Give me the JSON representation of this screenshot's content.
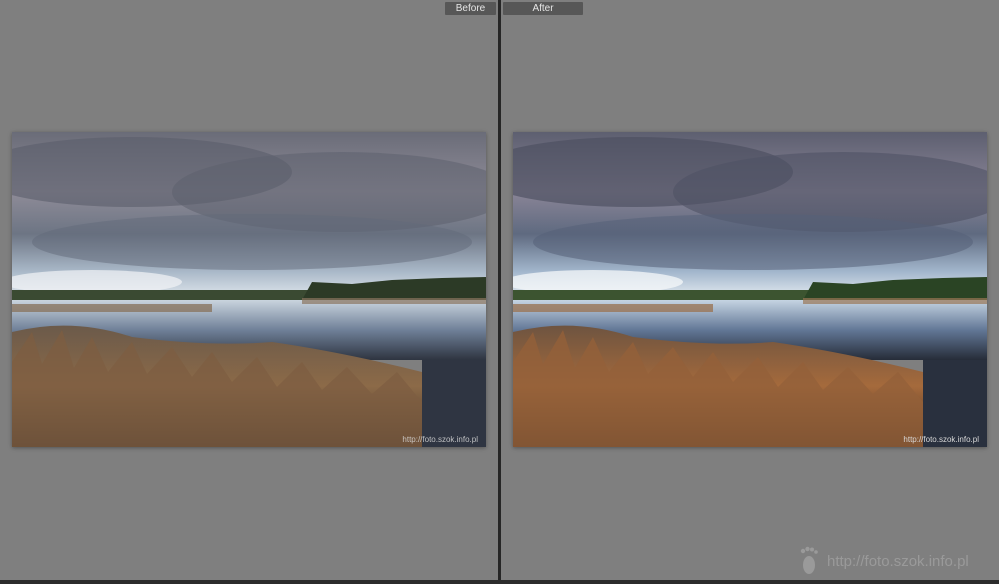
{
  "compare_view": {
    "before_label": "Before",
    "after_label": "After"
  },
  "photos": {
    "before_caption": "http://foto.szok.info.pl",
    "after_caption": "http://foto.szok.info.pl"
  },
  "watermark": {
    "text": "http://foto.szok.info.pl",
    "icon": "footprint-icon"
  },
  "colors": {
    "background": "#7f7f7f",
    "divider": "#262626",
    "label_bg": "#575757"
  }
}
